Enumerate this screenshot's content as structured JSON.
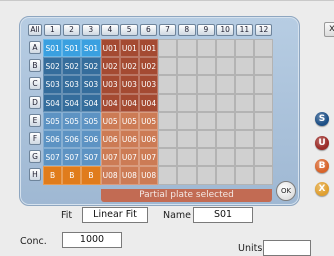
{
  "plate": {
    "all_label": "All",
    "columns": [
      "1",
      "2",
      "3",
      "4",
      "5",
      "6",
      "7",
      "8",
      "9",
      "10",
      "11",
      "12"
    ],
    "rows": [
      "A",
      "B",
      "C",
      "D",
      "E",
      "F",
      "G",
      "H"
    ],
    "wells": [
      [
        "S01",
        "S01",
        "S01",
        "U01",
        "U01",
        "U01"
      ],
      [
        "S02",
        "S02",
        "S02",
        "U02",
        "U02",
        "U02"
      ],
      [
        "S03",
        "S03",
        "S03",
        "U03",
        "U03",
        "U03"
      ],
      [
        "S04",
        "S04",
        "S04",
        "U04",
        "U04",
        "U04"
      ],
      [
        "S05",
        "S05",
        "S05",
        "U05",
        "U05",
        "U05"
      ],
      [
        "S06",
        "S06",
        "S06",
        "U06",
        "U06",
        "U06"
      ],
      [
        "S07",
        "S07",
        "S07",
        "U07",
        "U07",
        "U07"
      ],
      [
        "B",
        "B",
        "B",
        "U08",
        "U08",
        "U08"
      ]
    ],
    "status": "Partial plate selected",
    "ok_label": "OK",
    "colors": {
      "standard": "#356d9c",
      "standard_light": "#5d93c3",
      "selected": "#3aa0e0",
      "unknown": "#a44a32",
      "unknown_light": "#cc7b55",
      "blank": "#e07c1c",
      "empty": "#d0d0d0"
    }
  },
  "side_buttons": [
    {
      "label": "S",
      "color": "#1d4f86",
      "name": "standard-type-button"
    },
    {
      "label": "U",
      "color": "#9b2b27",
      "name": "unknown-type-button"
    },
    {
      "label": "B",
      "color": "#d8642b",
      "name": "blank-type-button"
    },
    {
      "label": "X",
      "color": "#e0a030",
      "name": "clear-type-button"
    }
  ],
  "close_label": "x",
  "form": {
    "fit_label": "Fit",
    "fit_value": "Linear Fit",
    "name_label": "Name",
    "name_value": "S01",
    "conc_label": "Conc.",
    "conc_value": "1000",
    "units_label": "Units",
    "units_value": ""
  }
}
